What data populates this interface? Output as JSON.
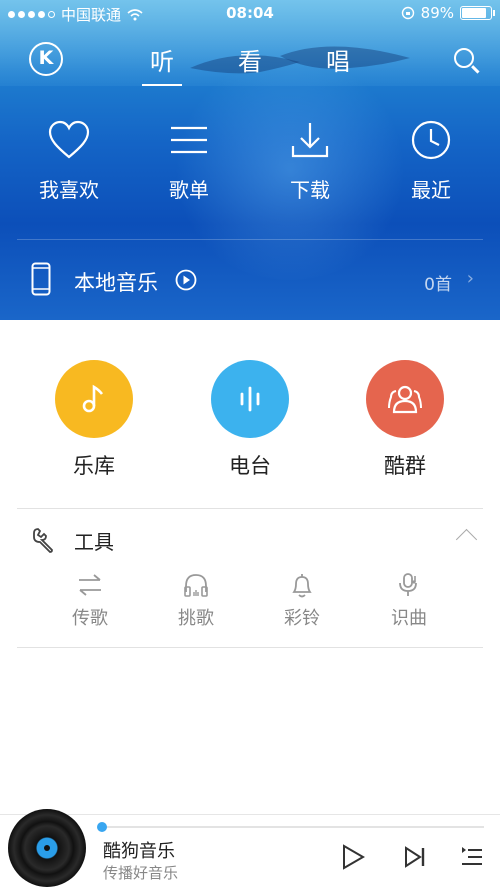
{
  "status_bar": {
    "carrier": "中国联通",
    "time": "08:04",
    "battery": "89%",
    "battery_level": 0.89,
    "signal_bars": 4
  },
  "top_nav": {
    "logo": "K",
    "tabs": [
      {
        "label": "听",
        "active": true
      },
      {
        "label": "看",
        "active": false
      },
      {
        "label": "唱",
        "active": false
      }
    ],
    "search_icon": "search-icon"
  },
  "quick_actions": [
    {
      "label": "我喜欢",
      "icon": "heart-icon"
    },
    {
      "label": "歌单",
      "icon": "list-icon"
    },
    {
      "label": "下载",
      "icon": "download-icon"
    },
    {
      "label": "最近",
      "icon": "clock-icon"
    }
  ],
  "local_music": {
    "label": "本地音乐",
    "count": "0首",
    "icon": "phone-icon"
  },
  "features": [
    {
      "label": "乐库",
      "icon": "music-note-icon",
      "color": "#f8b921"
    },
    {
      "label": "电台",
      "icon": "radio-bars-icon",
      "color": "#3cb2ee"
    },
    {
      "label": "酷群",
      "icon": "group-icon",
      "color": "#e5654e"
    }
  ],
  "tools": {
    "title": "工具",
    "items": [
      {
        "label": "传歌",
        "icon": "transfer-icon"
      },
      {
        "label": "挑歌",
        "icon": "headphones-icon"
      },
      {
        "label": "彩铃",
        "icon": "bell-icon"
      },
      {
        "label": "识曲",
        "icon": "mic-icon"
      }
    ]
  },
  "player": {
    "title": "酷狗音乐",
    "subtitle": "传播好音乐",
    "progress": 0
  },
  "colors": {
    "hero_blue": "#1464c6",
    "accent": "#39a6f0"
  }
}
